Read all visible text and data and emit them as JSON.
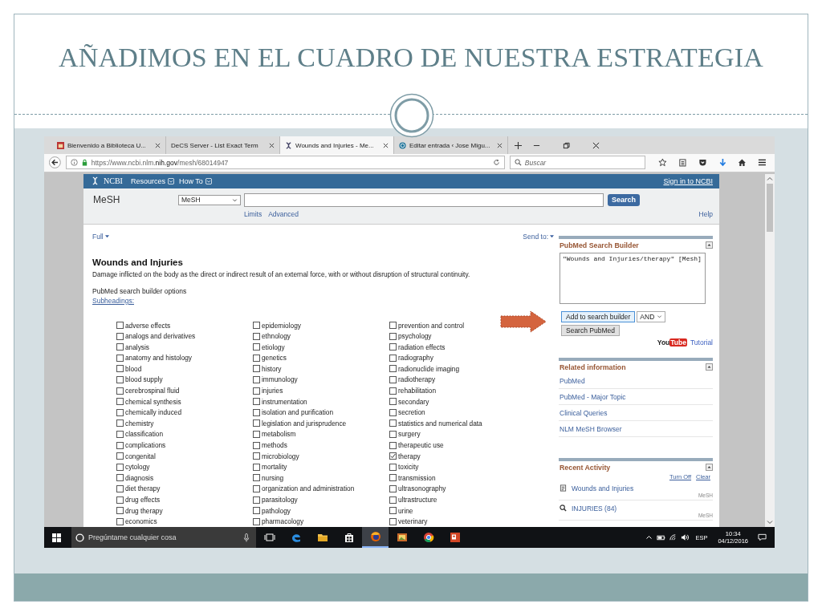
{
  "slide": {
    "title": "AÑADIMOS EN EL CUADRO DE NUESTRA ESTRATEGIA"
  },
  "browser": {
    "tabs": [
      {
        "label": "Bienvenido a Biblioteca U...",
        "selected": false,
        "kind": "photo"
      },
      {
        "label": "DeCS Server - List Exact Term",
        "selected": false,
        "kind": "plain"
      },
      {
        "label": "Wounds and Injuries - Me...",
        "selected": true,
        "kind": "helix"
      },
      {
        "label": "Editar entrada ‹ Jose Migu...",
        "selected": false,
        "kind": "globe"
      }
    ],
    "url": "https://www.ncbi.nlm.**nih.gov**/mesh/68014947",
    "search": {
      "placeholder": "Buscar"
    }
  },
  "ncbi": {
    "logo": "NCBI",
    "menus": [
      "Resources",
      "How To"
    ],
    "sign_in": "Sign in to NCBI",
    "db_label": "MeSH",
    "db_select": "MeSH",
    "search_button": "Search",
    "links": [
      "Limits",
      "Advanced"
    ],
    "help": "Help"
  },
  "main": {
    "display": "Full",
    "send_to": "Send to:",
    "heading": "Wounds and Injuries",
    "description": "Damage inflicted on the body as the direct or indirect result of an external force, with or without disruption of structural continuity.",
    "builder_options": "PubMed search builder options",
    "subheadings_link": "Subheadings:",
    "subheadings": [
      [
        {
          "label": "adverse effects",
          "checked": false
        },
        {
          "label": "analogs and derivatives",
          "checked": false
        },
        {
          "label": "analysis",
          "checked": false
        },
        {
          "label": "anatomy and histology",
          "checked": false
        },
        {
          "label": "blood",
          "checked": false
        },
        {
          "label": "blood supply",
          "checked": false
        },
        {
          "label": "cerebrospinal fluid",
          "checked": false
        },
        {
          "label": "chemical synthesis",
          "checked": false
        },
        {
          "label": "chemically induced",
          "checked": false
        },
        {
          "label": "chemistry",
          "checked": false
        },
        {
          "label": "classification",
          "checked": false
        },
        {
          "label": "complications",
          "checked": false
        },
        {
          "label": "congenital",
          "checked": false
        },
        {
          "label": "cytology",
          "checked": false
        },
        {
          "label": "diagnosis",
          "checked": false
        },
        {
          "label": "diet therapy",
          "checked": false
        },
        {
          "label": "drug effects",
          "checked": false
        },
        {
          "label": "drug therapy",
          "checked": false
        },
        {
          "label": "economics",
          "checked": false
        }
      ],
      [
        {
          "label": "epidemiology",
          "checked": false
        },
        {
          "label": "ethnology",
          "checked": false
        },
        {
          "label": "etiology",
          "checked": false
        },
        {
          "label": "genetics",
          "checked": false
        },
        {
          "label": "history",
          "checked": false
        },
        {
          "label": "immunology",
          "checked": false
        },
        {
          "label": "injuries",
          "checked": false
        },
        {
          "label": "instrumentation",
          "checked": false
        },
        {
          "label": "isolation and purification",
          "checked": false
        },
        {
          "label": "legislation and jurisprudence",
          "checked": false
        },
        {
          "label": "metabolism",
          "checked": false
        },
        {
          "label": "methods",
          "checked": false
        },
        {
          "label": "microbiology",
          "checked": false
        },
        {
          "label": "mortality",
          "checked": false
        },
        {
          "label": "nursing",
          "checked": false
        },
        {
          "label": "organization and administration",
          "checked": false
        },
        {
          "label": "parasitology",
          "checked": false
        },
        {
          "label": "pathology",
          "checked": false
        },
        {
          "label": "pharmacology",
          "checked": false
        }
      ],
      [
        {
          "label": "prevention and control",
          "checked": false
        },
        {
          "label": "psychology",
          "checked": false
        },
        {
          "label": "radiation effects",
          "checked": false
        },
        {
          "label": "radiography",
          "checked": false
        },
        {
          "label": "radionuclide imaging",
          "checked": false
        },
        {
          "label": "radiotherapy",
          "checked": false
        },
        {
          "label": "rehabilitation",
          "checked": false
        },
        {
          "label": "secondary",
          "checked": false
        },
        {
          "label": "secretion",
          "checked": false
        },
        {
          "label": "statistics and numerical data",
          "checked": false
        },
        {
          "label": "surgery",
          "checked": false
        },
        {
          "label": "therapeutic use",
          "checked": false
        },
        {
          "label": "therapy",
          "checked": true
        },
        {
          "label": "toxicity",
          "checked": false
        },
        {
          "label": "transmission",
          "checked": false
        },
        {
          "label": "ultrasonography",
          "checked": false
        },
        {
          "label": "ultrastructure",
          "checked": false
        },
        {
          "label": "urine",
          "checked": false
        },
        {
          "label": "veterinary",
          "checked": false
        }
      ]
    ]
  },
  "sidebar": {
    "builder": {
      "title": "PubMed Search Builder",
      "query": "\"Wounds and Injuries/therapy\" [Mesh]",
      "add_button": "Add to search builder",
      "operator": "AND",
      "search_button": "Search PubMed",
      "logo_you": "You",
      "logo_tube": "Tube",
      "tutorial": "Tutorial"
    },
    "related": {
      "title": "Related information",
      "links": [
        "PubMed",
        "PubMed - Major Topic",
        "Clinical Queries",
        "NLM MeSH Browser"
      ]
    },
    "recent": {
      "title": "Recent Activity",
      "turn_off": "Turn Off",
      "clear": "Clear",
      "items": [
        {
          "kind": "document",
          "label": "Wounds and Injuries",
          "db": "MeSH"
        },
        {
          "kind": "search",
          "label": "INJURIES (84)",
          "db": "MeSH"
        }
      ]
    }
  },
  "taskbar": {
    "search_placeholder": "Pregúntame cualquier cosa",
    "apps": [
      {
        "kind": "taskview",
        "selected": false
      },
      {
        "kind": "edge",
        "selected": false
      },
      {
        "kind": "folder",
        "selected": false
      },
      {
        "kind": "store",
        "selected": false
      },
      {
        "kind": "firefox",
        "selected": true
      },
      {
        "kind": "photos",
        "selected": false
      },
      {
        "kind": "chrome",
        "selected": false
      },
      {
        "kind": "slides",
        "selected": false
      }
    ],
    "language": "ESP",
    "time": "10:34",
    "date": "04/12/2016"
  }
}
